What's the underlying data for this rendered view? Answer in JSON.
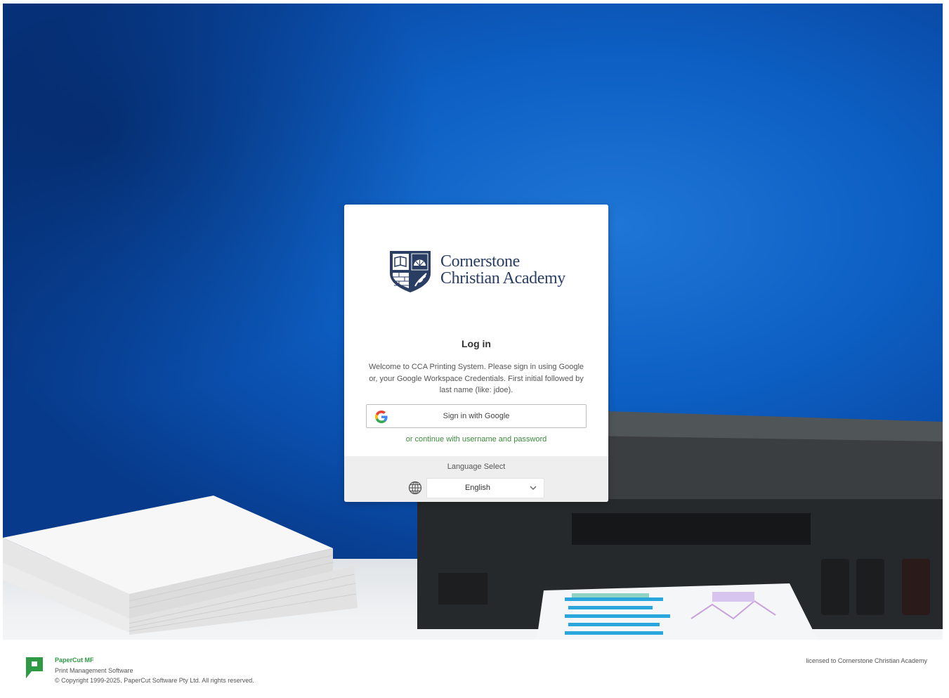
{
  "organization": {
    "name_line1": "Cornerstone",
    "name_line2": "Christian Academy"
  },
  "login": {
    "title": "Log in",
    "welcome": "Welcome to CCA Printing System. Please sign in using Google or, your Google Workspace Credentials. First initial followed by last name (like: jdoe).",
    "google_button_label": "Sign in with Google",
    "alt_login_link": "or continue with username and password"
  },
  "language": {
    "label": "Language Select",
    "selected": "English",
    "icon": "globe-icon"
  },
  "footer": {
    "product_name": "PaperCut MF",
    "product_sub": "Print Management Software",
    "copyright": "© Copyright 1999-2025. PaperCut Software Pty Ltd. All rights reserved.",
    "license": "licensed to Cornerstone Christian Academy"
  },
  "colors": {
    "brand_green": "#2e9a44",
    "link_green": "#3d8b3d",
    "org_navy": "#2a3d63",
    "background_blue": "#0d5fc3"
  }
}
